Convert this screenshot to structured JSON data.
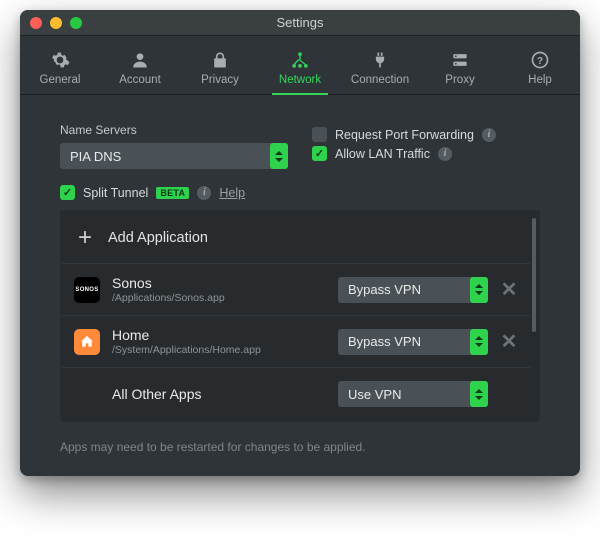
{
  "window": {
    "title": "Settings"
  },
  "tabs": [
    {
      "label": "General"
    },
    {
      "label": "Account"
    },
    {
      "label": "Privacy"
    },
    {
      "label": "Network"
    },
    {
      "label": "Connection"
    },
    {
      "label": "Proxy"
    },
    {
      "label": "Help"
    }
  ],
  "nameServers": {
    "label": "Name Servers",
    "value": "PIA DNS"
  },
  "options": {
    "portForwarding": {
      "label": "Request Port Forwarding",
      "checked": false
    },
    "allowLan": {
      "label": "Allow LAN Traffic",
      "checked": true
    }
  },
  "splitTunnel": {
    "label": "Split Tunnel",
    "badge": "BETA",
    "helpLabel": "Help"
  },
  "apps": {
    "addLabel": "Add Application",
    "rows": [
      {
        "name": "Sonos",
        "path": "/Applications/Sonos.app",
        "mode": "Bypass VPN"
      },
      {
        "name": "Home",
        "path": "/System/Applications/Home.app",
        "mode": "Bypass VPN"
      }
    ],
    "allOther": {
      "label": "All Other Apps",
      "mode": "Use VPN"
    }
  },
  "footer": "Apps may need to be restarted for changes to be applied.",
  "colors": {
    "accent": "#2fd24d"
  }
}
